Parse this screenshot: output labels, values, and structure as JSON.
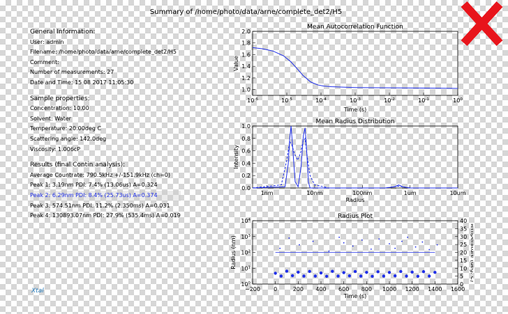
{
  "window": {
    "title": "Summary of /home/photo/data/arne/complete_det2/H5"
  },
  "general": {
    "heading": "General Information:",
    "lines": [
      "User: admin",
      "Filename: /home/photo/data/arne/complete_det2/H5",
      "Comment:",
      "Number of measurements: 27",
      "Date and Time: 15 08 2017 11:05:30"
    ]
  },
  "sample": {
    "heading": "Sample properties:",
    "lines": [
      "Concentration: 10.00",
      "Solvent: Water",
      "Temperature: 20.00deg C",
      "Scattering angle: 142.0deg",
      "Viscosity: 1.006cP"
    ]
  },
  "results": {
    "heading": "Results (final Contin analysis):",
    "countrate": "Average Countrate: 790.5kHz +/-151.9kHz (ch=0)",
    "peaks": [
      "Peak 1: 3.19nm  PDI: 7.4% (13.06us) A=0.324",
      "Peak 2: 6.29nm  PDI: 8.4% (25.73us) A=0.374",
      "Peak 3: 574.51nm  PDI: 11.2% (2.350ms) A=0.031",
      "Peak 4: 130893.07nm  PDI: 27.9% (535.4ms) A=0.019"
    ],
    "highlight_color": "#1f2fe8"
  },
  "logo": {
    "text": "Xtal"
  },
  "icons": {
    "close": "close-icon",
    "close_color": "#e8141b"
  },
  "colors": {
    "series": "#1f2fe8",
    "axis": "#000000"
  },
  "chart_data": [
    {
      "type": "line",
      "title": "Mean Autocorrelation Function",
      "xlabel": "Time (s)",
      "ylabel": "Value",
      "xscale": "log",
      "xlim": [
        1e-06,
        1
      ],
      "ylim": [
        0.9,
        2.0
      ],
      "x_ticks": [
        "10-6",
        "10-5",
        "10-4",
        "10-3",
        "10-2",
        "10-1",
        "100"
      ],
      "y_ticks": [
        "1.0",
        "1.2",
        "1.4",
        "1.6",
        "1.8",
        "2.0"
      ],
      "series": [
        {
          "x": [
            1e-06,
            2e-06,
            4e-06,
            8e-06,
            1.3e-05,
            2e-05,
            3e-05,
            5e-05,
            8e-05,
            0.00012,
            0.0002,
            0.0005,
            0.001,
            0.01,
            0.1,
            1
          ],
          "y": [
            1.72,
            1.7,
            1.66,
            1.58,
            1.48,
            1.36,
            1.24,
            1.13,
            1.08,
            1.06,
            1.05,
            1.04,
            1.035,
            1.03,
            1.025,
            1.02
          ]
        }
      ]
    },
    {
      "type": "line",
      "title": "Mean Radius Distribution",
      "xlabel": "Radius",
      "ylabel": "Intensity",
      "xscale": "log",
      "xlim": [
        0.5,
        10000
      ],
      "ylim": [
        0,
        1.0
      ],
      "x_ticks": [
        "1nm",
        "10nm",
        "100nm",
        "1um",
        "10um"
      ],
      "y_ticks": [
        "0.0",
        "0.2",
        "0.4",
        "0.6",
        "0.8",
        "1.0"
      ],
      "series": [
        {
          "name": "solid",
          "x": [
            0.5,
            2.4,
            2.8,
            3.0,
            3.2,
            3.5,
            3.9,
            4.5,
            5.2,
            5.8,
            6.3,
            6.8,
            7.4,
            8.0,
            20,
            300,
            480,
            575,
            700,
            1000,
            10000
          ],
          "y": [
            0.0,
            0.02,
            0.4,
            0.8,
            1.0,
            0.6,
            0.1,
            0.02,
            0.35,
            0.85,
            0.97,
            0.6,
            0.1,
            0.0,
            0.0,
            0.0,
            0.02,
            0.05,
            0.02,
            0.0,
            0.0
          ]
        },
        {
          "name": "dashed",
          "x": [
            0.5,
            2.0,
            2.6,
            3.0,
            3.3,
            3.8,
            4.4,
            5.0,
            5.7,
            6.3,
            7.0,
            8.0,
            10,
            20,
            300,
            575,
            1000,
            10000
          ],
          "y": [
            0.0,
            0.05,
            0.45,
            0.75,
            0.7,
            0.55,
            0.45,
            0.55,
            0.75,
            0.8,
            0.5,
            0.2,
            0.05,
            0.0,
            0.0,
            0.03,
            0.0,
            0.0
          ]
        }
      ]
    },
    {
      "type": "scatter",
      "title": "Radius Plot",
      "xlabel": "Time (s)",
      "ylabel": "Radius (nm)",
      "y2label": "Temperature (deg. C)",
      "xlim": [
        -200,
        1600
      ],
      "yscale": "log",
      "ylim": [
        1,
        10000
      ],
      "y2lim": [
        0,
        40
      ],
      "x_ticks": [
        "-200",
        "0",
        "200",
        "400",
        "600",
        "800",
        "1000",
        "1200",
        "1400",
        "1600"
      ],
      "y_ticks": [
        "100",
        "101",
        "102",
        "103",
        "104"
      ],
      "y2_ticks": [
        "0",
        "5",
        "10",
        "15",
        "20",
        "25",
        "30",
        "35",
        "40"
      ],
      "series": [
        {
          "name": "large-dots",
          "x": [
            0,
            50,
            100,
            150,
            200,
            250,
            300,
            350,
            400,
            450,
            500,
            550,
            600,
            650,
            700,
            750,
            800,
            850,
            900,
            950,
            1000,
            1050,
            1100,
            1150,
            1200,
            1250,
            1300,
            1350,
            1400
          ],
          "y": [
            4.8,
            3.2,
            6.5,
            3.4,
            5.6,
            3.2,
            6.3,
            3.2,
            5.0,
            3.1,
            6.4,
            3.2,
            5.3,
            3.3,
            6.2,
            3.2,
            5.5,
            3.1,
            6.0,
            3.2,
            5.4,
            3.3,
            6.2,
            3.2,
            5.7,
            3.1,
            6.1,
            3.2,
            5.5
          ]
        },
        {
          "name": "small-dots",
          "x": [
            40,
            120,
            210,
            330,
            470,
            560,
            600,
            680,
            760,
            840,
            910,
            1000,
            1050,
            1110,
            1160,
            1230,
            1290,
            1350,
            1420
          ],
          "y": [
            180,
            800,
            300,
            500,
            120,
            900,
            400,
            250,
            600,
            160,
            700,
            350,
            180,
            500,
            900,
            220,
            450,
            150,
            300
          ]
        },
        {
          "name": "temperature",
          "x": [
            0,
            1400
          ],
          "y": [
            20,
            20
          ]
        }
      ]
    }
  ]
}
